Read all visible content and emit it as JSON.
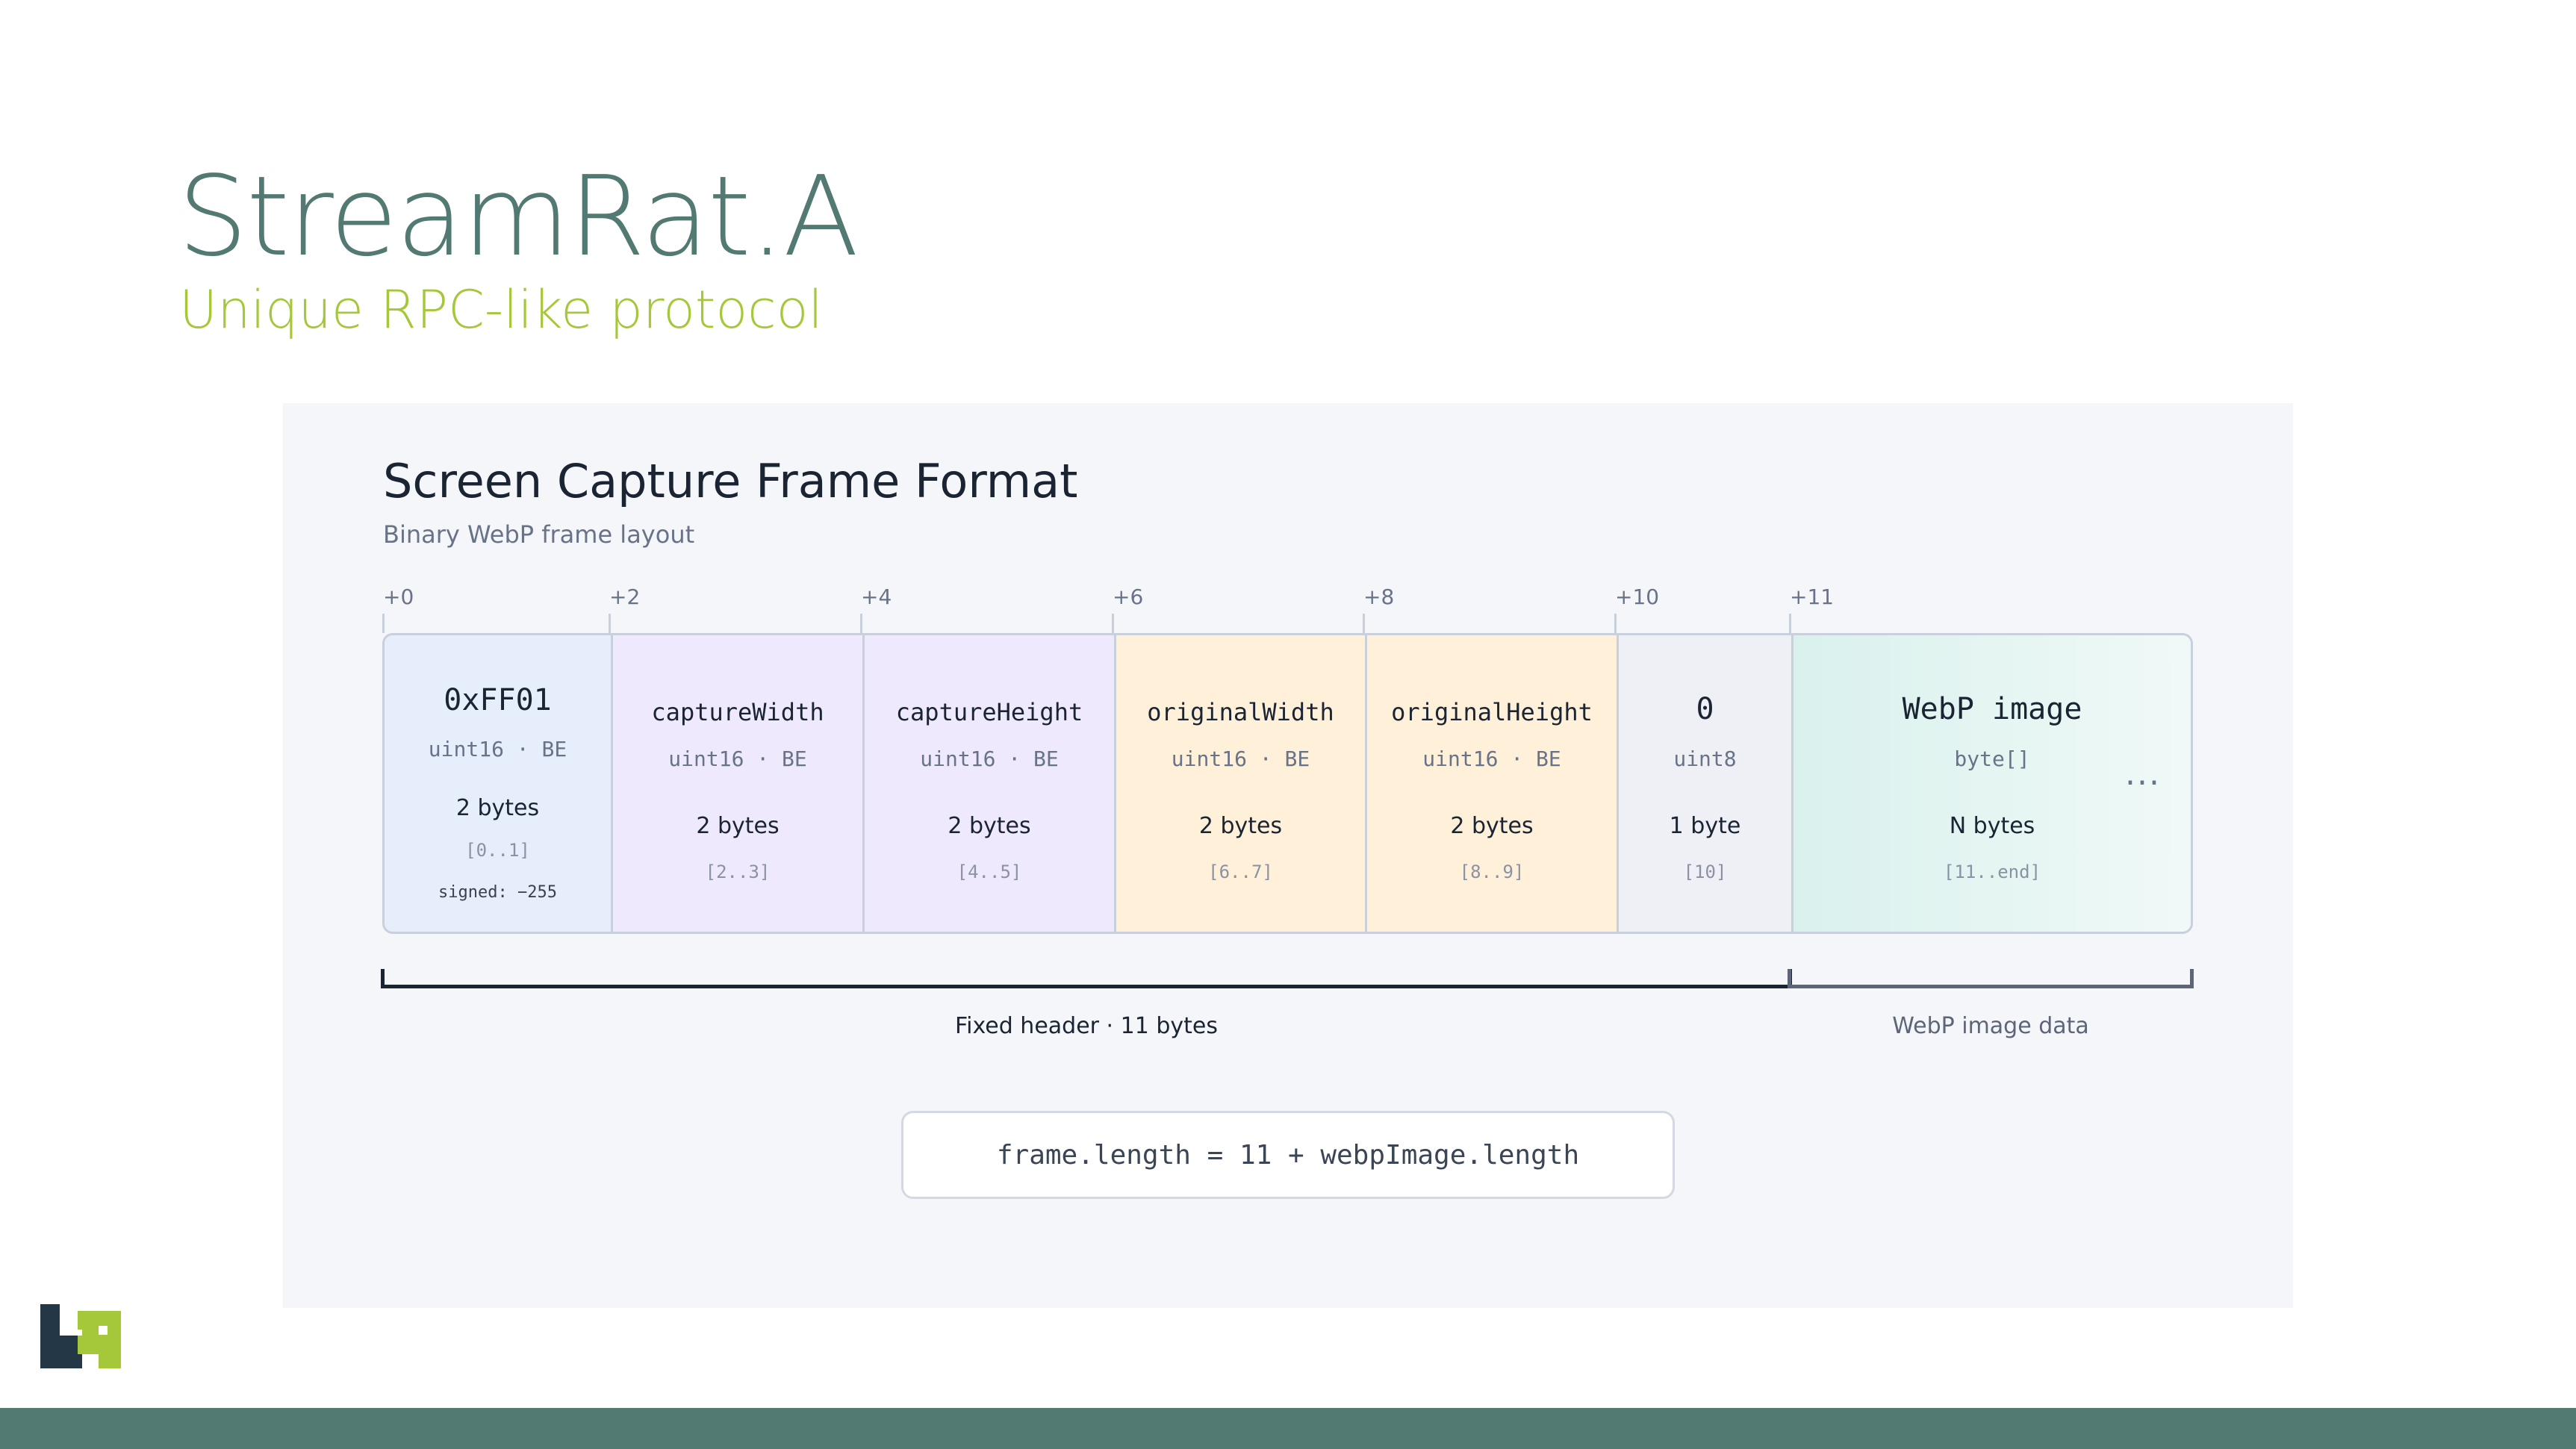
{
  "slide": {
    "title": "StreamRat.A",
    "subtitle": "Unique RPC-like protocol"
  },
  "diagram": {
    "title": "Screen Capture Frame Format",
    "subtitle": "Binary WebP frame layout",
    "offsets": [
      "+0",
      "+2",
      "+4",
      "+6",
      "+8",
      "+10",
      "+11"
    ],
    "fields": [
      {
        "name": "0xFF01",
        "type": "uint16 · BE",
        "size": "2 bytes",
        "range": "[0..1]",
        "note": "signed: −255",
        "color": "#e6eefc"
      },
      {
        "name": "captureWidth",
        "type": "uint16 · BE",
        "size": "2 bytes",
        "range": "[2..3]",
        "color": "#efe9fd"
      },
      {
        "name": "captureHeight",
        "type": "uint16 · BE",
        "size": "2 bytes",
        "range": "[4..5]",
        "color": "#efe9fd"
      },
      {
        "name": "originalWidth",
        "type": "uint16 · BE",
        "size": "2 bytes",
        "range": "[6..7]",
        "color": "#fff0da"
      },
      {
        "name": "originalHeight",
        "type": "uint16 · BE",
        "size": "2 bytes",
        "range": "[8..9]",
        "color": "#fff0da"
      },
      {
        "name": "0",
        "type": "uint8",
        "size": "1 byte",
        "range": "[10]",
        "color": "#eef0f5"
      },
      {
        "name": "WebP image",
        "type": "byte[]",
        "size": "N bytes",
        "range": "[11..end]",
        "ellipsis": "...",
        "color": "#d9f1ed"
      }
    ],
    "brackets": {
      "header_label": "Fixed header · 11 bytes",
      "data_label": "WebP image data",
      "header_color": "#1a2433",
      "data_color": "#5d6678"
    },
    "formula": "frame.length = 11 + webpImage.length"
  },
  "colors": {
    "title": "#527a72",
    "subtitle": "#a5c73a",
    "panel": "#f5f6fa",
    "footer": "#527a72",
    "logo_dark": "#243746",
    "logo_green": "#a5c73a"
  }
}
